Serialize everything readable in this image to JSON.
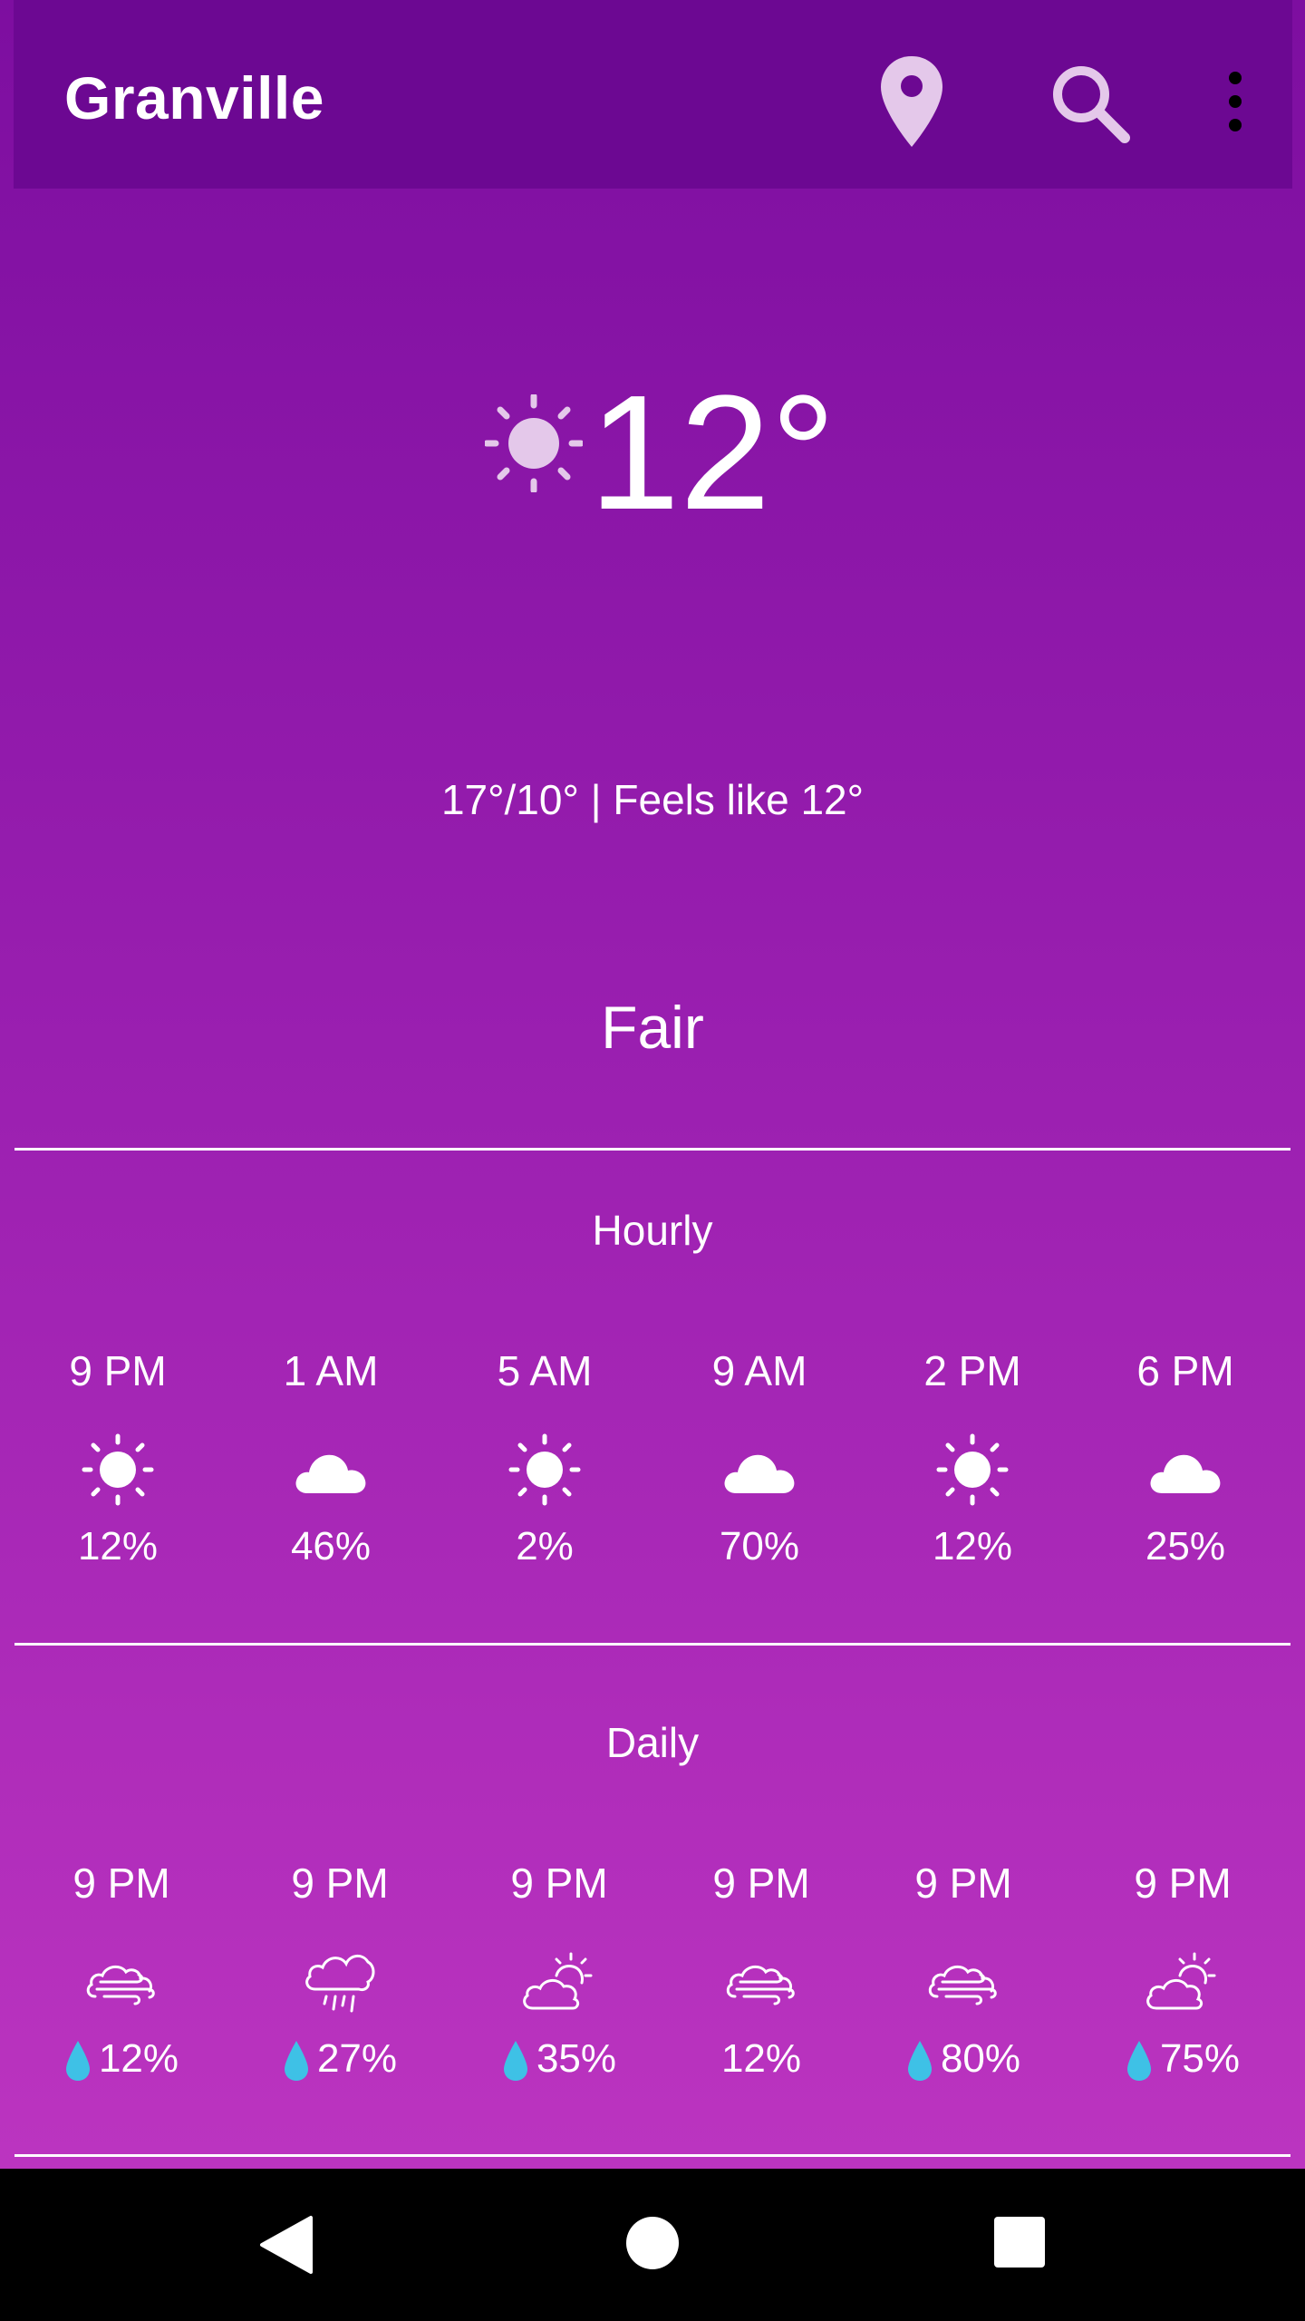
{
  "app_bar": {
    "title": "Granville",
    "icons": [
      "location-pin-icon",
      "search-icon",
      "more-vert-icon"
    ]
  },
  "current": {
    "icon": "sun-icon",
    "temperature": "12°",
    "high_low_feels": "17°/10° | Feels like 12°",
    "condition": "Fair"
  },
  "hourly": {
    "title": "Hourly",
    "items": [
      {
        "time": "9 PM",
        "icon": "sun-icon",
        "pct": "12%"
      },
      {
        "time": "1 AM",
        "icon": "cloud-icon",
        "pct": "46%"
      },
      {
        "time": "5 AM",
        "icon": "sun-icon",
        "pct": "2%"
      },
      {
        "time": "9 AM",
        "icon": "cloud-icon",
        "pct": "70%"
      },
      {
        "time": "2 PM",
        "icon": "sun-icon",
        "pct": "12%"
      },
      {
        "time": "6 PM",
        "icon": "cloud-icon",
        "pct": "25%"
      }
    ]
  },
  "daily": {
    "title": "Daily",
    "items": [
      {
        "time": "9 PM",
        "icon": "wind-icon",
        "pct": "12%",
        "drop": true
      },
      {
        "time": "9 PM",
        "icon": "rain-cloud-icon",
        "pct": "27%",
        "drop": true
      },
      {
        "time": "9 PM",
        "icon": "partly-cloudy-icon",
        "pct": "35%",
        "drop": true
      },
      {
        "time": "9 PM",
        "icon": "wind-icon",
        "pct": "12%",
        "drop": false
      },
      {
        "time": "9 PM",
        "icon": "wind-icon",
        "pct": "80%",
        "drop": true
      },
      {
        "time": "9 PM",
        "icon": "partly-cloudy-icon",
        "pct": "75%",
        "drop": true
      }
    ]
  },
  "colors": {
    "appbar": "#6c0892",
    "gradient_top": "#7d0ea0",
    "gradient_bottom": "#c037c2",
    "drop": "#3ec1e6",
    "icon_light": "#e4c8ea"
  },
  "nav_bar": [
    "back-icon",
    "home-icon",
    "recents-icon"
  ]
}
